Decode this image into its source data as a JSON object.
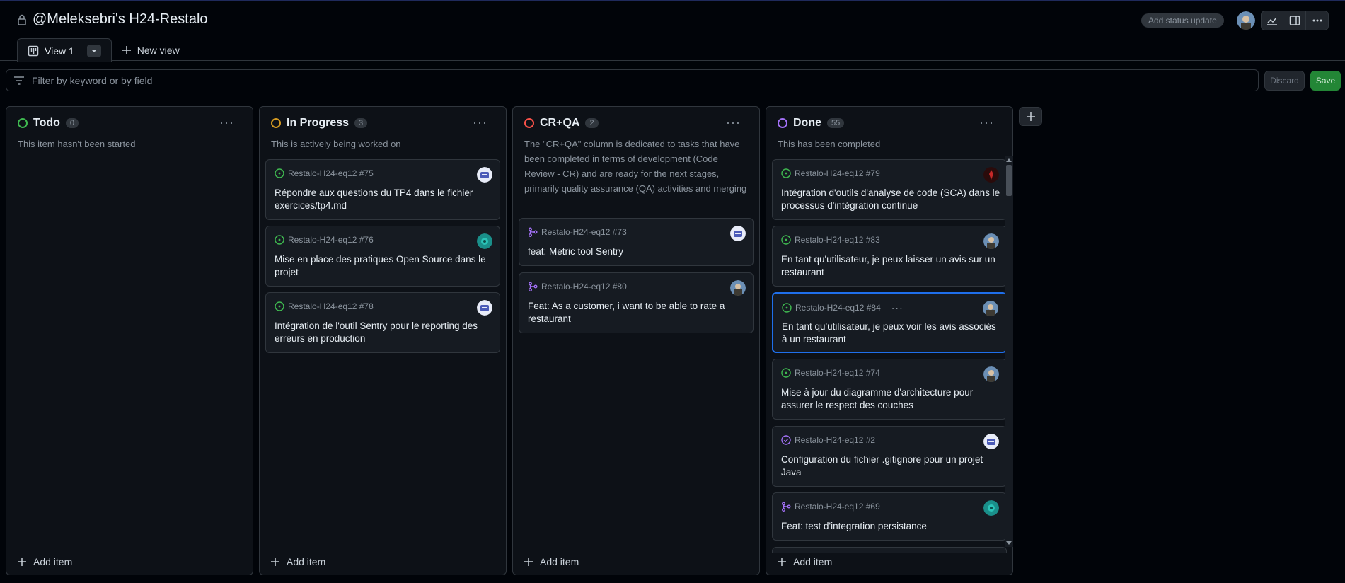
{
  "project": {
    "title": "@Meleksebri's H24-Restalo"
  },
  "header": {
    "status_update_label": "Add status update"
  },
  "tabs": {
    "active_label": "View 1",
    "new_view_label": "New view"
  },
  "filter": {
    "placeholder": "Filter by keyword or by field"
  },
  "actions": {
    "discard_label": "Discard",
    "save_label": "Save"
  },
  "colors": {
    "todo": "#238636",
    "in_progress": "#d29922",
    "cr_qa": "#da3633",
    "done": "#8957e5",
    "accent": "#1f6feb"
  },
  "columns": [
    {
      "name": "Todo",
      "count": "0",
      "status_color": "#3fb950",
      "description": "This item hasn't been started",
      "add_label": "Add item",
      "cards": []
    },
    {
      "name": "In Progress",
      "count": "3",
      "status_color": "#d29922",
      "description": "This is actively being worked on",
      "add_label": "Add item",
      "cards": [
        {
          "ref": "Restalo-H24-eq12 #75",
          "title": "Répondre aux questions du TP4 dans le fichier exercices/tp4.md",
          "kind": "issue-open",
          "avatar": "robot"
        },
        {
          "ref": "Restalo-H24-eq12 #76",
          "title": "Mise en place des pratiques Open Source dans le projet",
          "kind": "issue-open",
          "avatar": "teal"
        },
        {
          "ref": "Restalo-H24-eq12 #78",
          "title": "Intégration de l'outil Sentry pour le reporting des erreurs en production",
          "kind": "issue-open",
          "avatar": "robot"
        }
      ]
    },
    {
      "name": "CR+QA",
      "count": "2",
      "status_color": "#f85149",
      "description": "The \"CR+QA\" column is dedicated to tasks that have been completed in terms of development (Code Review - CR) and are ready for the next stages, primarily quality assurance (QA) activities and merging",
      "add_label": "Add item",
      "cards": [
        {
          "ref": "Restalo-H24-eq12 #73",
          "title": "feat: Metric tool Sentry",
          "kind": "pr-merged",
          "avatar": "robot"
        },
        {
          "ref": "Restalo-H24-eq12 #80",
          "title": "Feat: As a customer, i want to be able to rate a restaurant",
          "kind": "pr-merged",
          "avatar": "photo"
        }
      ]
    },
    {
      "name": "Done",
      "count": "55",
      "status_color": "#a371f7",
      "description": "This has been completed",
      "add_label": "Add item",
      "cards": [
        {
          "ref": "Restalo-H24-eq12 #79",
          "title": "Intégration d'outils d'analyse de code (SCA) dans le processus d'intégration continue",
          "kind": "issue-open",
          "avatar": "red"
        },
        {
          "ref": "Restalo-H24-eq12 #83",
          "title": "En tant qu'utilisateur, je peux laisser un avis sur un restaurant",
          "kind": "issue-open",
          "avatar": "photo"
        },
        {
          "ref": "Restalo-H24-eq12 #84",
          "title": "En tant qu'utilisateur, je peux voir les avis associés à un restaurant",
          "kind": "issue-open",
          "avatar": "photo",
          "selected": true
        },
        {
          "ref": "Restalo-H24-eq12 #74",
          "title": "Mise à jour du diagramme d'architecture pour assurer le respect des couches",
          "kind": "issue-open",
          "avatar": "photo"
        },
        {
          "ref": "Restalo-H24-eq12 #2",
          "title": "Configuration du fichier .gitignore pour un projet Java",
          "kind": "issue-closed",
          "avatar": "robot"
        },
        {
          "ref": "Restalo-H24-eq12 #69",
          "title": "Feat: test d'integration persistance",
          "kind": "pr-merged",
          "avatar": "teal"
        }
      ]
    }
  ]
}
